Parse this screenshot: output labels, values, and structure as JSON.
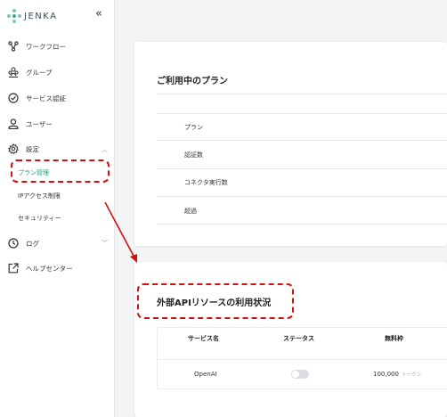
{
  "app": {
    "name": "JENKA",
    "collapse_glyph": "«"
  },
  "sidebar": {
    "items": [
      {
        "label": "ワークフロー",
        "icon": "workflow-icon"
      },
      {
        "label": "グループ",
        "icon": "group-icon"
      },
      {
        "label": "サービス認証",
        "icon": "check-circle-icon"
      },
      {
        "label": "ユーザー",
        "icon": "user-icon"
      },
      {
        "label": "設定",
        "icon": "gear-icon"
      },
      {
        "label": "ログ",
        "icon": "clock-icon"
      },
      {
        "label": "ヘルプセンター",
        "icon": "external-link-icon"
      }
    ],
    "settings_sub": [
      {
        "label": "プラン管理",
        "active": true
      },
      {
        "label": "IPアクセス制限",
        "active": false
      },
      {
        "label": "セキュリティー",
        "active": false
      }
    ]
  },
  "plan_card": {
    "title": "ご利用中のプラン",
    "rows": [
      "プラン",
      "認証数",
      "コネクタ実行数",
      "超過"
    ]
  },
  "api_card": {
    "title": "外部APIリソースの利用状況",
    "columns": [
      "サービス名",
      "ステータス",
      "無料枠"
    ],
    "rows": [
      {
        "service": "OpenAI",
        "status_on": false,
        "free_quota": "100,000",
        "unit": "トークン"
      }
    ]
  },
  "colors": {
    "accent": "#2a9a86",
    "annotation": "#d21010"
  }
}
